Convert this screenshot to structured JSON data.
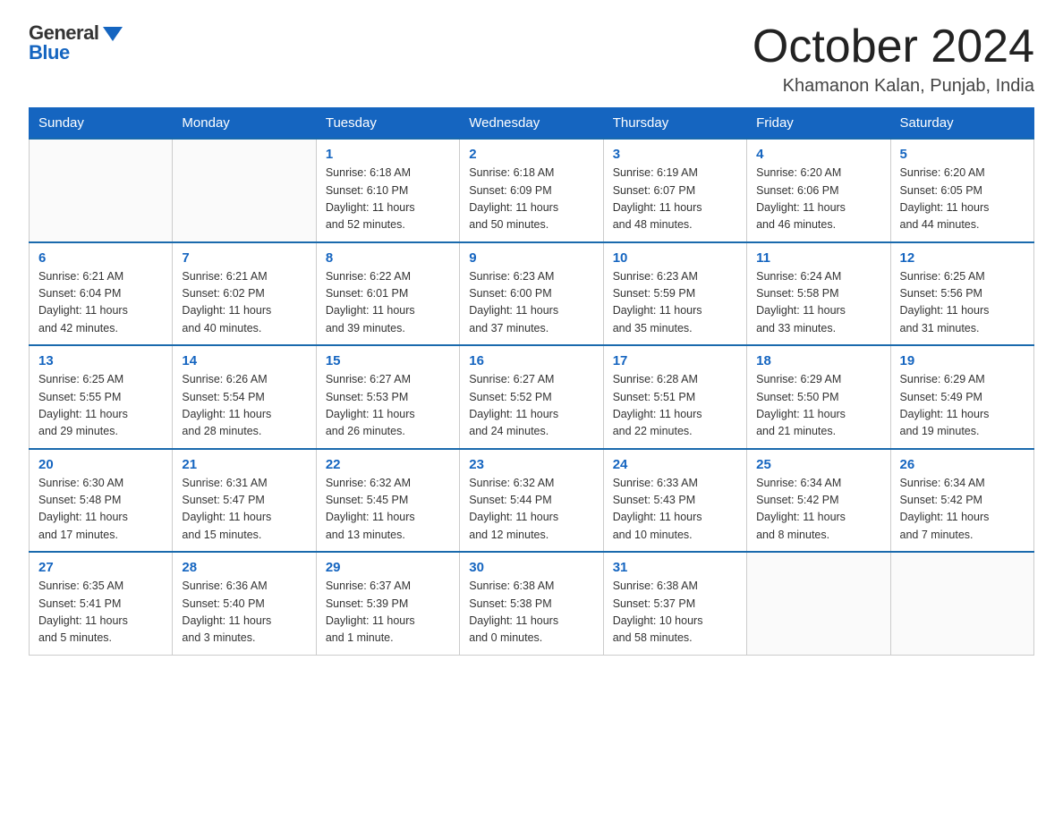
{
  "logo": {
    "general": "General",
    "blue": "Blue"
  },
  "header": {
    "title": "October 2024",
    "location": "Khamanon Kalan, Punjab, India"
  },
  "days_of_week": [
    "Sunday",
    "Monday",
    "Tuesday",
    "Wednesday",
    "Thursday",
    "Friday",
    "Saturday"
  ],
  "weeks": [
    [
      {
        "day": "",
        "info": ""
      },
      {
        "day": "",
        "info": ""
      },
      {
        "day": "1",
        "info": "Sunrise: 6:18 AM\nSunset: 6:10 PM\nDaylight: 11 hours\nand 52 minutes."
      },
      {
        "day": "2",
        "info": "Sunrise: 6:18 AM\nSunset: 6:09 PM\nDaylight: 11 hours\nand 50 minutes."
      },
      {
        "day": "3",
        "info": "Sunrise: 6:19 AM\nSunset: 6:07 PM\nDaylight: 11 hours\nand 48 minutes."
      },
      {
        "day": "4",
        "info": "Sunrise: 6:20 AM\nSunset: 6:06 PM\nDaylight: 11 hours\nand 46 minutes."
      },
      {
        "day": "5",
        "info": "Sunrise: 6:20 AM\nSunset: 6:05 PM\nDaylight: 11 hours\nand 44 minutes."
      }
    ],
    [
      {
        "day": "6",
        "info": "Sunrise: 6:21 AM\nSunset: 6:04 PM\nDaylight: 11 hours\nand 42 minutes."
      },
      {
        "day": "7",
        "info": "Sunrise: 6:21 AM\nSunset: 6:02 PM\nDaylight: 11 hours\nand 40 minutes."
      },
      {
        "day": "8",
        "info": "Sunrise: 6:22 AM\nSunset: 6:01 PM\nDaylight: 11 hours\nand 39 minutes."
      },
      {
        "day": "9",
        "info": "Sunrise: 6:23 AM\nSunset: 6:00 PM\nDaylight: 11 hours\nand 37 minutes."
      },
      {
        "day": "10",
        "info": "Sunrise: 6:23 AM\nSunset: 5:59 PM\nDaylight: 11 hours\nand 35 minutes."
      },
      {
        "day": "11",
        "info": "Sunrise: 6:24 AM\nSunset: 5:58 PM\nDaylight: 11 hours\nand 33 minutes."
      },
      {
        "day": "12",
        "info": "Sunrise: 6:25 AM\nSunset: 5:56 PM\nDaylight: 11 hours\nand 31 minutes."
      }
    ],
    [
      {
        "day": "13",
        "info": "Sunrise: 6:25 AM\nSunset: 5:55 PM\nDaylight: 11 hours\nand 29 minutes."
      },
      {
        "day": "14",
        "info": "Sunrise: 6:26 AM\nSunset: 5:54 PM\nDaylight: 11 hours\nand 28 minutes."
      },
      {
        "day": "15",
        "info": "Sunrise: 6:27 AM\nSunset: 5:53 PM\nDaylight: 11 hours\nand 26 minutes."
      },
      {
        "day": "16",
        "info": "Sunrise: 6:27 AM\nSunset: 5:52 PM\nDaylight: 11 hours\nand 24 minutes."
      },
      {
        "day": "17",
        "info": "Sunrise: 6:28 AM\nSunset: 5:51 PM\nDaylight: 11 hours\nand 22 minutes."
      },
      {
        "day": "18",
        "info": "Sunrise: 6:29 AM\nSunset: 5:50 PM\nDaylight: 11 hours\nand 21 minutes."
      },
      {
        "day": "19",
        "info": "Sunrise: 6:29 AM\nSunset: 5:49 PM\nDaylight: 11 hours\nand 19 minutes."
      }
    ],
    [
      {
        "day": "20",
        "info": "Sunrise: 6:30 AM\nSunset: 5:48 PM\nDaylight: 11 hours\nand 17 minutes."
      },
      {
        "day": "21",
        "info": "Sunrise: 6:31 AM\nSunset: 5:47 PM\nDaylight: 11 hours\nand 15 minutes."
      },
      {
        "day": "22",
        "info": "Sunrise: 6:32 AM\nSunset: 5:45 PM\nDaylight: 11 hours\nand 13 minutes."
      },
      {
        "day": "23",
        "info": "Sunrise: 6:32 AM\nSunset: 5:44 PM\nDaylight: 11 hours\nand 12 minutes."
      },
      {
        "day": "24",
        "info": "Sunrise: 6:33 AM\nSunset: 5:43 PM\nDaylight: 11 hours\nand 10 minutes."
      },
      {
        "day": "25",
        "info": "Sunrise: 6:34 AM\nSunset: 5:42 PM\nDaylight: 11 hours\nand 8 minutes."
      },
      {
        "day": "26",
        "info": "Sunrise: 6:34 AM\nSunset: 5:42 PM\nDaylight: 11 hours\nand 7 minutes."
      }
    ],
    [
      {
        "day": "27",
        "info": "Sunrise: 6:35 AM\nSunset: 5:41 PM\nDaylight: 11 hours\nand 5 minutes."
      },
      {
        "day": "28",
        "info": "Sunrise: 6:36 AM\nSunset: 5:40 PM\nDaylight: 11 hours\nand 3 minutes."
      },
      {
        "day": "29",
        "info": "Sunrise: 6:37 AM\nSunset: 5:39 PM\nDaylight: 11 hours\nand 1 minute."
      },
      {
        "day": "30",
        "info": "Sunrise: 6:38 AM\nSunset: 5:38 PM\nDaylight: 11 hours\nand 0 minutes."
      },
      {
        "day": "31",
        "info": "Sunrise: 6:38 AM\nSunset: 5:37 PM\nDaylight: 10 hours\nand 58 minutes."
      },
      {
        "day": "",
        "info": ""
      },
      {
        "day": "",
        "info": ""
      }
    ]
  ]
}
